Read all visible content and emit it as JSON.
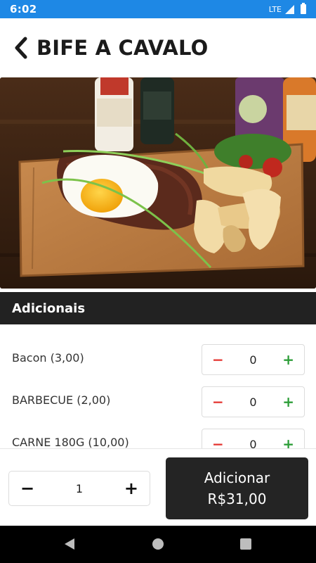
{
  "status_bar": {
    "time": "6:02",
    "network": "LTE"
  },
  "header": {
    "back_icon": "chevron-left-icon",
    "title": "BIFE A CAVALO"
  },
  "hero_image": {
    "description_icon": "food-photo"
  },
  "section": {
    "title": "Adicionais"
  },
  "addons": [
    {
      "label": "Bacon (3,00)",
      "quantity": "0",
      "minus": "−",
      "plus": "+"
    },
    {
      "label": "BARBECUE (2,00)",
      "quantity": "0",
      "minus": "−",
      "plus": "+"
    },
    {
      "label": "CARNE 180G (10,00)",
      "quantity": "0",
      "minus": "−",
      "plus": "+"
    }
  ],
  "order": {
    "quantity": "1",
    "minus": "−",
    "plus": "+",
    "add_label": "Adicionar",
    "add_price": "R$31,00"
  },
  "colors": {
    "status_bar": "#1e88e5",
    "section_bg": "#222222",
    "add_button": "#242424",
    "minus": "#e53935",
    "plus": "#2e9e3a"
  },
  "nav": {
    "back": "triangle-back-icon",
    "home": "circle-home-icon",
    "recents": "square-recents-icon"
  }
}
